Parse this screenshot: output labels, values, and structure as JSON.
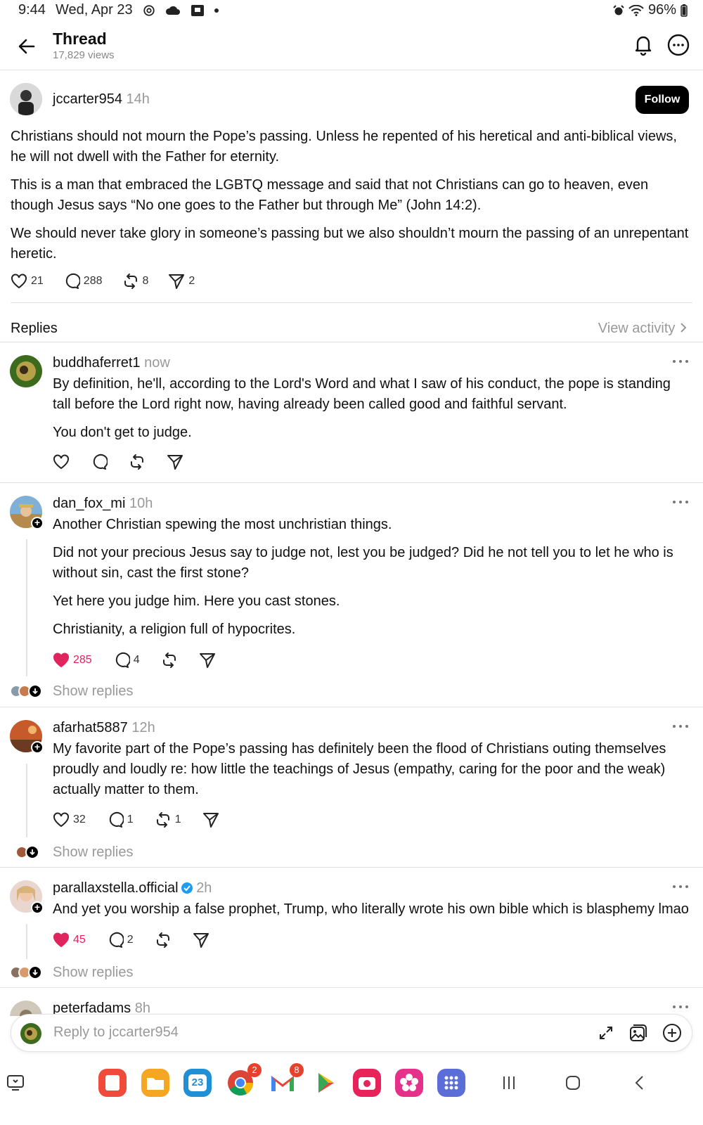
{
  "status_bar": {
    "time": "9:44",
    "date": "Wed, Apr 23",
    "battery": "96%"
  },
  "header": {
    "title": "Thread",
    "views": "17,829 views"
  },
  "post": {
    "username": "jccarter954",
    "time": "14h",
    "follow_label": "Follow",
    "paragraphs": [
      "Christians should not mourn the Pope’s passing. Unless he repented of his heretical and anti-biblical views, he will not dwell with the Father for eternity.",
      "This is a man that embraced the LGBTQ message and said that not Christians can go to heaven, even though Jesus says “No one goes to the Father but through Me” (John 14:2).",
      "We should never take glory in someone’s passing but we also shouldn’t mourn the passing of an unrepentant heretic."
    ],
    "likes": "21",
    "comments": "288",
    "reposts": "8",
    "shares": "2"
  },
  "replies_header": {
    "label": "Replies",
    "view_activity": "View activity"
  },
  "replies": [
    {
      "username": "buddhaferret1",
      "time": "now",
      "paragraphs": [
        "By definition, he'll, according to the Lord's Word and what I saw of his conduct,  the pope is standing tall before the Lord right now,  having already been called good and faithful servant.",
        "You don't get to judge."
      ]
    },
    {
      "username": "dan_fox_mi",
      "time": "10h",
      "paragraphs": [
        "Another Christian spewing the most unchristian things.",
        "Did not your precious Jesus say to judge not, lest you be judged? Did he not tell you to let he who is without sin, cast the first stone?",
        "Yet here you judge him. Here you cast stones.",
        "Christianity, a religion full of hypocrites."
      ],
      "likes": "285",
      "comments": "4",
      "show_replies": "Show replies"
    },
    {
      "username": "afarhat5887",
      "time": "12h",
      "paragraphs": [
        "My favorite part of the Pope’s passing has definitely been the flood of Christians outing themselves proudly and loudly re: how little the teachings of Jesus (empathy, caring for the poor and the weak) actually matter to them."
      ],
      "likes": "32",
      "comments": "1",
      "reposts": "1",
      "show_replies": "Show replies"
    },
    {
      "username": "parallaxstella.official",
      "time": "2h",
      "paragraphs": [
        "And yet you worship a false prophet, Trump, who literally wrote his own bible which is blasphemy lmao"
      ],
      "likes": "45",
      "comments": "2",
      "show_replies": "Show replies"
    },
    {
      "username": "peterfadams",
      "time": "8h"
    }
  ],
  "composer": {
    "placeholder": "Reply to jccarter954"
  },
  "nav": {
    "calendar_day": "23",
    "chrome_badge": "2",
    "gmail_badge": "8"
  },
  "colors": {
    "like_red": "#e0245e",
    "verified_blue": "#1d9bf0",
    "follow_bg": "#000000"
  }
}
